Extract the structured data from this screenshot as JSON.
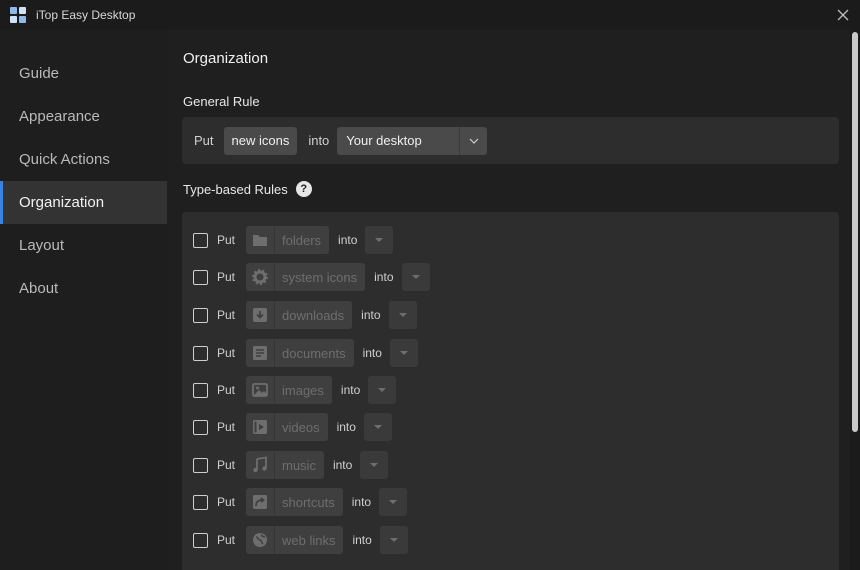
{
  "window": {
    "title": "iTop Easy Desktop"
  },
  "sidebar": {
    "items": [
      {
        "label": "Guide"
      },
      {
        "label": "Appearance"
      },
      {
        "label": "Quick Actions"
      },
      {
        "label": "Organization",
        "active": true
      },
      {
        "label": "Layout"
      },
      {
        "label": "About"
      }
    ]
  },
  "main": {
    "title": "Organization",
    "general_rule": {
      "title": "General Rule",
      "put_label": "Put",
      "item_chip": "new icons",
      "into_label": "into",
      "destination": "Your desktop"
    },
    "type_rules": {
      "title": "Type-based Rules",
      "help_glyph": "?",
      "rules": [
        {
          "put": "Put",
          "type": "folders",
          "into": "into",
          "icon": "folder-icon",
          "checked": false
        },
        {
          "put": "Put",
          "type": "system icons",
          "into": "into",
          "icon": "gear-icon",
          "checked": false
        },
        {
          "put": "Put",
          "type": "downloads",
          "into": "into",
          "icon": "download-icon",
          "checked": false
        },
        {
          "put": "Put",
          "type": "documents",
          "into": "into",
          "icon": "document-icon",
          "checked": false
        },
        {
          "put": "Put",
          "type": "images",
          "into": "into",
          "icon": "image-icon",
          "checked": false
        },
        {
          "put": "Put",
          "type": "videos",
          "into": "into",
          "icon": "video-icon",
          "checked": false
        },
        {
          "put": "Put",
          "type": "music",
          "into": "into",
          "icon": "music-icon",
          "checked": false
        },
        {
          "put": "Put",
          "type": "shortcuts",
          "into": "into",
          "icon": "shortcut-icon",
          "checked": false
        },
        {
          "put": "Put",
          "type": "web links",
          "into": "into",
          "icon": "globe-icon",
          "checked": false
        }
      ]
    }
  },
  "colors": {
    "accent": "#3b83e0",
    "background": "#1f1f1f",
    "panel": "#2d2d2d"
  }
}
